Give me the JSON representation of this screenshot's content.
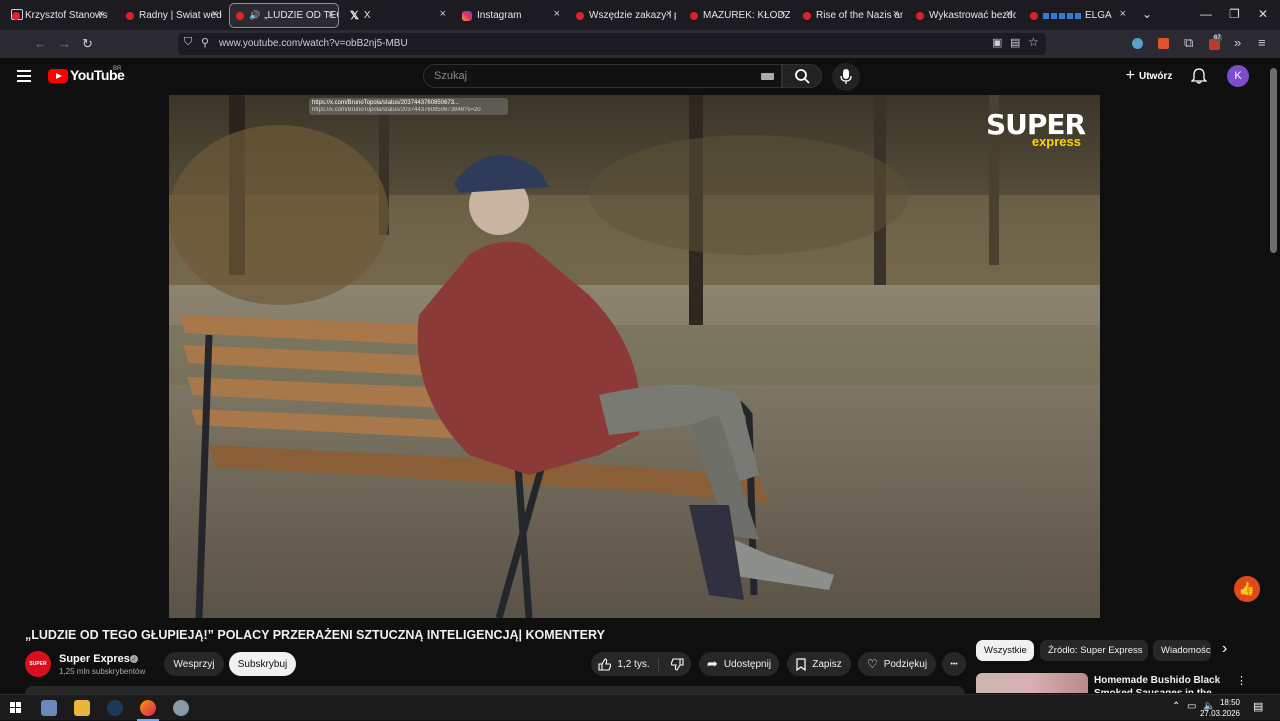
{
  "browser": {
    "tabs": [
      {
        "label": "Krzysztof Stanowski: I",
        "icon": "youtube-icon"
      },
      {
        "label": "Radny | Świat według",
        "icon": "youtube-icon"
      },
      {
        "label": "„LUDZIE OD TEGO",
        "icon": "youtube-icon",
        "active": true
      },
      {
        "label": "X",
        "icon": "x-icon"
      },
      {
        "label": "Instagram",
        "icon": "instagram-icon"
      },
      {
        "label": "Wszędzie zakazy i pr",
        "icon": "youtube-icon"
      },
      {
        "label": "MAZUREK: KŁODZKO",
        "icon": "youtube-icon"
      },
      {
        "label": "Rise of the Nazis and",
        "icon": "youtube-icon"
      },
      {
        "label": "Wykastrować bezdom",
        "icon": "youtube-icon"
      },
      {
        "label": "ELGA",
        "icon": "youtube-icon"
      }
    ],
    "tab_close_glyph": "×",
    "url": "www.youtube.com/watch?v=obB2nj5-MBU",
    "extension_badge": "67"
  },
  "youtube": {
    "logo_text": "YouTube",
    "logo_region": "BR",
    "search_placeholder": "Szukaj",
    "create_label": "Utwórz",
    "avatar_letter": "K"
  },
  "video": {
    "tooltip_line1": "https://x.com/BrunoTopola/status/2037443760850673...",
    "tooltip_line2": "https://x.com/BrunoTopola/status/2037443760850673848?s=20",
    "watermark_line1": "SUPER",
    "watermark_line2": "express"
  },
  "info": {
    "title": "„LUDZIE OD TEGO GŁUPIEJĄ!” POLACY PRZERAŻENI SZTUCZNĄ INTELIGENCJĄ| KOMENTERY",
    "channel_name": "Super Express",
    "channel_avatar_text": "SUPER",
    "subscribers": "1,25 mln subskrybentów",
    "support_label": "Wesprzyj",
    "subscribe_label": "Subskrybuj",
    "likes": "1,2 tys.",
    "share_label": "Udostępnij",
    "save_label": "Zapisz",
    "thanks_label": "Podziękuj",
    "more_glyph": "•••"
  },
  "sidebar": {
    "chips": [
      {
        "label": "Wszystkie",
        "selected": true
      },
      {
        "label": "Źródło: Super Express",
        "selected": false
      },
      {
        "label": "Wiadomości",
        "selected": false
      }
    ],
    "next_glyph": "›",
    "recommendation_title": "Homemade Bushido Black Smoked Sausages in the"
  },
  "taskbar": {
    "time": "18:50",
    "date": "27.03.2026"
  },
  "colors": {
    "brand_red": "#ff0000",
    "page_bg": "#0f0f0f",
    "pill_bg": "#272727",
    "accent_avatar": "#7c4dcc"
  }
}
